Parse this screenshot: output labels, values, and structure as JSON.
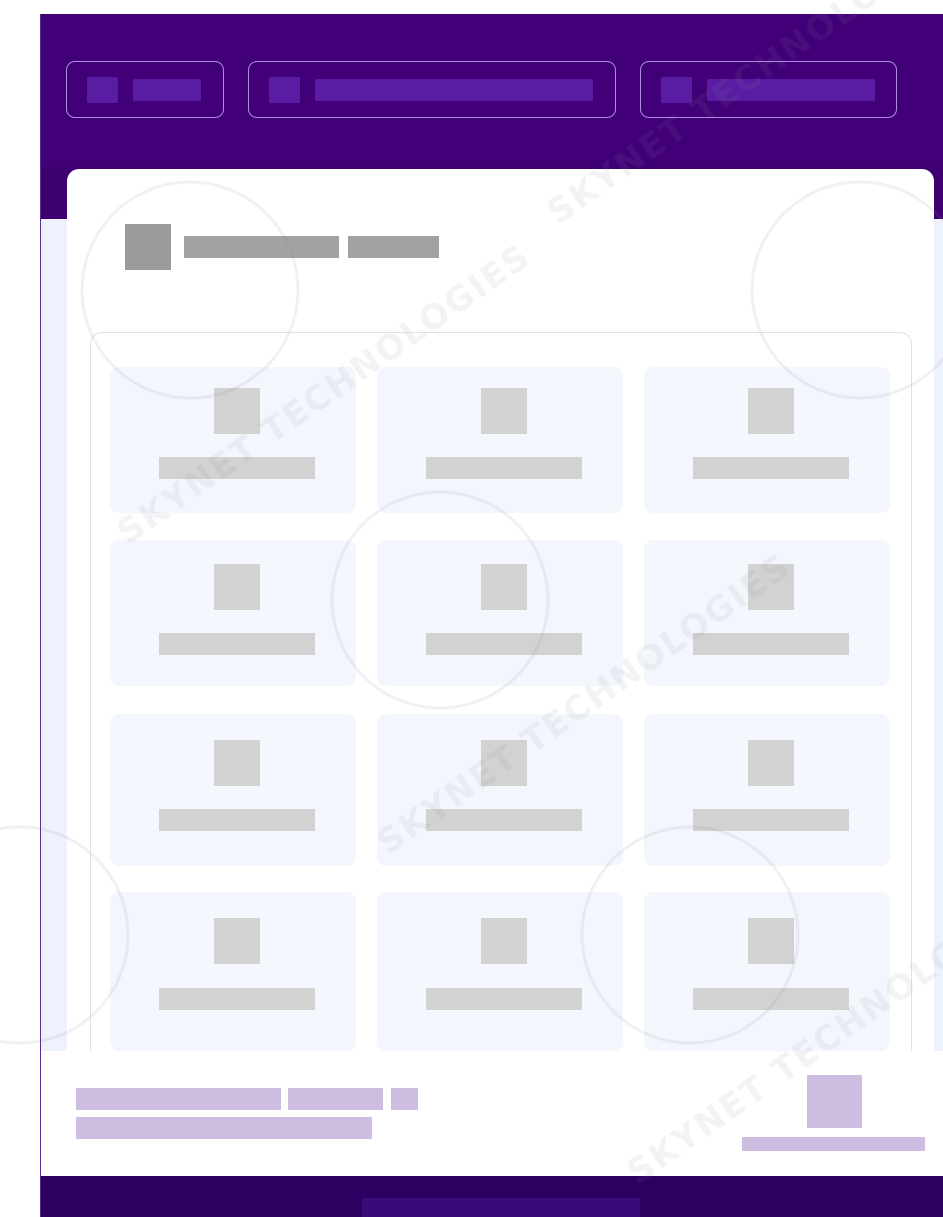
{
  "header": {
    "nav_buttons": [
      {
        "name": "nav-button-1"
      },
      {
        "name": "nav-button-2"
      },
      {
        "name": "nav-button-3"
      }
    ]
  },
  "section": {
    "tile_count": 12
  },
  "watermark": {
    "text": "SKYNET TECHNOLOGIES"
  },
  "colors": {
    "header_bg": "#420078",
    "placeholder_dark": "#a2a2a2",
    "placeholder_light": "#d2d2d2",
    "tile_bg": "#f3f6fc",
    "footer_placeholder": "#cdbde1",
    "bottom_bar": "#2b0060"
  }
}
